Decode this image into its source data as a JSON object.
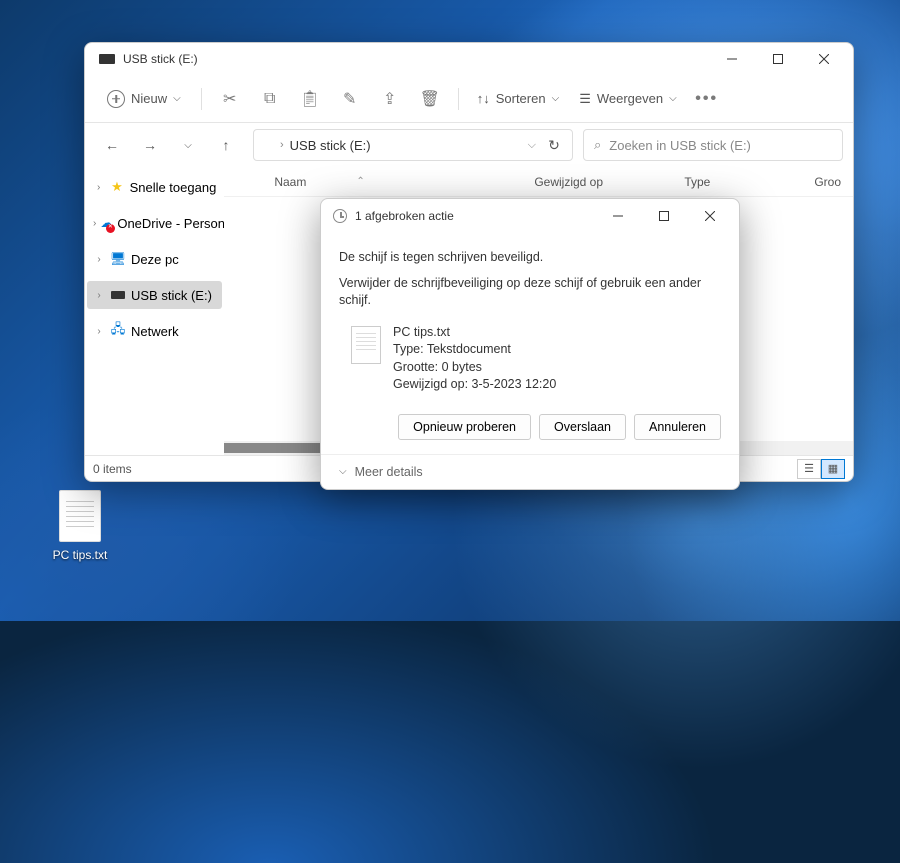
{
  "window": {
    "title": "USB stick (E:)",
    "new_label": "Nieuw",
    "sort_label": "Sorteren",
    "view_label": "Weergeven",
    "breadcrumb": "USB stick (E:)",
    "search_placeholder": "Zoeken in USB stick (E:)",
    "status": "0 items"
  },
  "columns": {
    "name": "Naam",
    "modified": "Gewijzigd op",
    "type": "Type",
    "size": "Groo"
  },
  "sidebar": {
    "quick": "Snelle toegang",
    "onedrive": "OneDrive - Personal",
    "thispc": "Deze pc",
    "usb": "USB stick (E:)",
    "network": "Netwerk"
  },
  "dialog": {
    "title": "1 afgebroken actie",
    "line1": "De schijf is tegen schrijven beveiligd.",
    "line2": "Verwijder de schrijfbeveiliging op deze schijf of gebruik een ander schijf.",
    "file_name": "PC tips.txt",
    "file_type": "Type: Tekstdocument",
    "file_size": "Grootte: 0 bytes",
    "file_modified": "Gewijzigd op: 3-5-2023 12:20",
    "retry": "Opnieuw proberen",
    "skip": "Overslaan",
    "cancel": "Annuleren",
    "more": "Meer details"
  },
  "desktop": {
    "file": "PC tips.txt"
  }
}
